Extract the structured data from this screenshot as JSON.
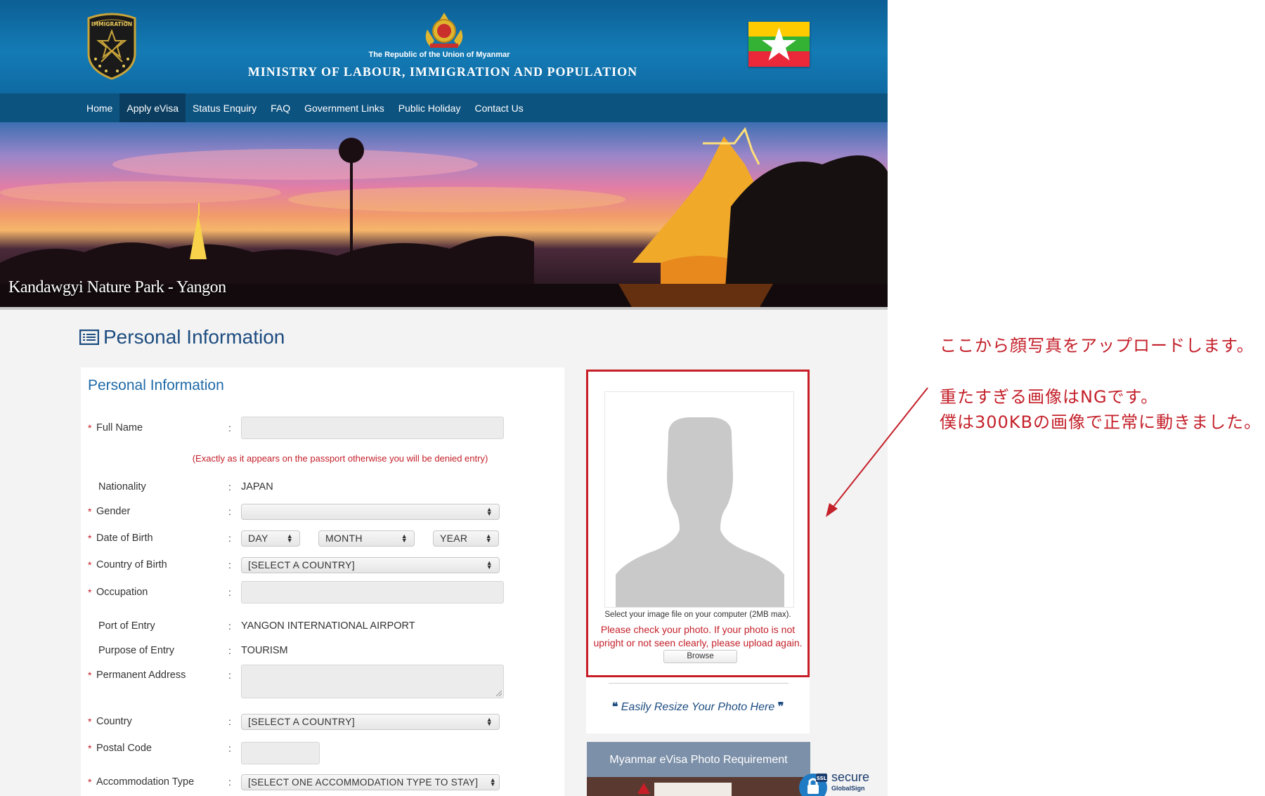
{
  "header": {
    "republic": "The Republic of the Union of Myanmar",
    "ministry": "MINISTRY OF  LABOUR, IMMIGRATION AND POPULATION",
    "emblem_text": "IMMIGRATION",
    "emblem_icon": "immigration-badge-icon",
    "crest_icon": "state-seal-icon",
    "flag_icon": "myanmar-flag-icon"
  },
  "nav": {
    "items": [
      {
        "label": "Home"
      },
      {
        "label": "Apply eVisa",
        "active": true
      },
      {
        "label": "Status Enquiry"
      },
      {
        "label": "FAQ"
      },
      {
        "label": "Government Links"
      },
      {
        "label": "Public Holiday"
      },
      {
        "label": "Contact Us"
      }
    ]
  },
  "banner": {
    "caption": "Kandawgyi Nature Park - Yangon"
  },
  "page": {
    "title": "Personal Information"
  },
  "form": {
    "panel_title": "Personal Information",
    "full_name": {
      "label": "Full Name",
      "value": "",
      "note": "(Exactly as it appears on the passport otherwise you will be denied entry)"
    },
    "nationality": {
      "label": "Nationality",
      "value": "JAPAN"
    },
    "gender": {
      "label": "Gender",
      "value": ""
    },
    "dob": {
      "label": "Date of Birth",
      "day": "DAY",
      "month": "MONTH",
      "year": "YEAR"
    },
    "country_of_birth": {
      "label": "Country of Birth",
      "value": "[SELECT A COUNTRY]"
    },
    "occupation": {
      "label": "Occupation",
      "value": ""
    },
    "port_of_entry": {
      "label": "Port of Entry",
      "value": "YANGON INTERNATIONAL AIRPORT"
    },
    "purpose_of_entry": {
      "label": "Purpose of Entry",
      "value": "TOURISM"
    },
    "permanent_address": {
      "label": "Permanent Address",
      "value": ""
    },
    "country": {
      "label": "Country",
      "value": "[SELECT A COUNTRY]"
    },
    "postal_code": {
      "label": "Postal Code",
      "value": ""
    },
    "accommodation_type": {
      "label": "Accommodation Type",
      "value": "[SELECT ONE ACCOMMODATION TYPE TO STAY]"
    },
    "colon": ":",
    "required_mark": "*"
  },
  "photo": {
    "help": "Select your image file on your computer (2MB max).",
    "warning_line1": "Please check your photo. If your photo is not",
    "warning_line2": "upright or not seen clearly, please upload again.",
    "browse": "Browse",
    "resize_link": "Easily Resize Your Photo Here",
    "requirement_title": "Myanmar eVisa Photo Requirement"
  },
  "ssl": {
    "secure": "secure",
    "provider": "GlobalSign"
  },
  "annotations": {
    "line1": "ここから顔写真をアップロードします。",
    "line2": "重たすぎる画像はNGです。",
    "line3": "僕は300KBの画像で正常に動きました。",
    "color": "#c4202a"
  },
  "colors": {
    "header_blue": "#147bb5",
    "nav_blue": "#0d5380",
    "accent_red": "#c81e28",
    "title_blue": "#1d4c80"
  }
}
